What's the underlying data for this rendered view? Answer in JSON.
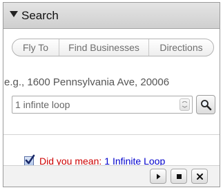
{
  "header": {
    "title": "Search",
    "collapse_icon": "triangle-down-icon"
  },
  "tabs": [
    {
      "label": "Fly To"
    },
    {
      "label": "Find Businesses"
    },
    {
      "label": "Directions"
    }
  ],
  "search": {
    "hint": "e.g., 1600 Pennsylvania Ave, 20006",
    "value": "1 infinte loop",
    "dropdown_icon": "chevron-down-icon",
    "button_icon": "magnifier-icon"
  },
  "suggestion": {
    "checked": true,
    "label": "Did you mean:",
    "link": "1 Infinite Loop"
  },
  "controls": [
    {
      "icon": "play-icon"
    },
    {
      "icon": "stop-icon"
    },
    {
      "icon": "close-icon"
    }
  ],
  "colors": {
    "suggestion_label": "#cc0000",
    "link": "#0000cc"
  }
}
